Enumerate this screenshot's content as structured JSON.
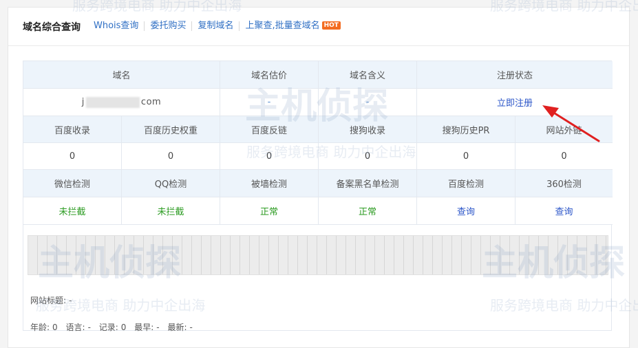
{
  "header": {
    "title": "域名综合查询",
    "links": [
      "Whois查询",
      "委托购买",
      "复制域名",
      "上聚查,批量查域名"
    ],
    "hot_badge": "HOT"
  },
  "table": {
    "row1_headers": [
      "域名",
      "域名估价",
      "域名含义",
      "注册状态"
    ],
    "row1_values": {
      "domain_prefix": "j",
      "domain_suffix": "com",
      "valuation": "-",
      "meaning": "-",
      "register_link": "立即注册"
    },
    "row2_headers": [
      "百度收录",
      "百度历史权重",
      "百度反链",
      "搜狗收录",
      "搜狗历史PR",
      "网站外链"
    ],
    "row2_values": [
      "0",
      "0",
      "0",
      "0",
      "0",
      "0"
    ],
    "row3_headers": [
      "微信检测",
      "QQ检测",
      "被墙检测",
      "备案黑名单检测",
      "百度检测",
      "360检测"
    ],
    "row3_values": [
      "未拦截",
      "未拦截",
      "正常",
      "正常",
      "查询",
      "查询"
    ]
  },
  "site_info": {
    "title_label": "网站标题:",
    "title_value": "-",
    "age_label": "年龄:",
    "age_value": "0",
    "lang_label": "语言:",
    "lang_value": "-",
    "records_label": "记录:",
    "records_value": "0",
    "earliest_label": "最早:",
    "earliest_value": "-",
    "latest_label": "最新:",
    "latest_value": "-"
  },
  "watermark": {
    "brand": "主机侦探",
    "slogan": "服务跨境电商 助力中企出海"
  },
  "colors": {
    "link_blue": "#2f6fc4",
    "header_bg": "#edf4fb",
    "ok_green": "#2b9b21",
    "query_blue": "#2a54c8",
    "hot_orange": "#f36c21",
    "arrow_red": "#e02020"
  }
}
